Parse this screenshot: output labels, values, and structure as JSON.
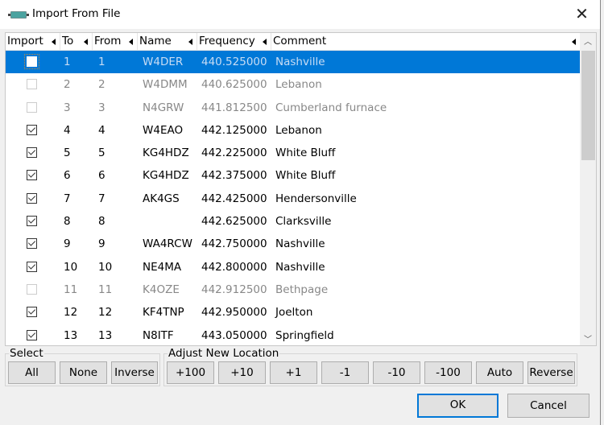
{
  "window": {
    "title": "Import From File",
    "icon": "serial-port-icon",
    "close_glyph": "✕"
  },
  "columns": [
    {
      "key": "import",
      "label": "Import"
    },
    {
      "key": "to",
      "label": "To"
    },
    {
      "key": "from",
      "label": "From"
    },
    {
      "key": "name",
      "label": "Name"
    },
    {
      "key": "frequency",
      "label": "Frequency"
    },
    {
      "key": "comment",
      "label": "Comment"
    }
  ],
  "rows": [
    {
      "import": false,
      "to": "1",
      "from": "1",
      "name": "W4DER",
      "frequency": "440.525000",
      "comment": "Nashville",
      "selected": true,
      "disabled": false
    },
    {
      "import": false,
      "to": "2",
      "from": "2",
      "name": "W4DMM",
      "frequency": "440.625000",
      "comment": "Lebanon",
      "selected": false,
      "disabled": true
    },
    {
      "import": false,
      "to": "3",
      "from": "3",
      "name": "N4GRW",
      "frequency": "441.812500",
      "comment": "Cumberland furnace",
      "selected": false,
      "disabled": true
    },
    {
      "import": true,
      "to": "4",
      "from": "4",
      "name": "W4EAO",
      "frequency": "442.125000",
      "comment": "Lebanon",
      "selected": false,
      "disabled": false
    },
    {
      "import": true,
      "to": "5",
      "from": "5",
      "name": "KG4HDZ",
      "frequency": "442.225000",
      "comment": "White Bluff",
      "selected": false,
      "disabled": false
    },
    {
      "import": true,
      "to": "6",
      "from": "6",
      "name": "KG4HDZ",
      "frequency": "442.375000",
      "comment": "White Bluff",
      "selected": false,
      "disabled": false
    },
    {
      "import": true,
      "to": "7",
      "from": "7",
      "name": "AK4GS",
      "frequency": "442.425000",
      "comment": "Hendersonville",
      "selected": false,
      "disabled": false
    },
    {
      "import": true,
      "to": "8",
      "from": "8",
      "name": "",
      "frequency": "442.625000",
      "comment": "Clarksville",
      "selected": false,
      "disabled": false
    },
    {
      "import": true,
      "to": "9",
      "from": "9",
      "name": "WA4RCW",
      "frequency": "442.750000",
      "comment": "Nashville",
      "selected": false,
      "disabled": false
    },
    {
      "import": true,
      "to": "10",
      "from": "10",
      "name": "NE4MA",
      "frequency": "442.800000",
      "comment": "Nashville",
      "selected": false,
      "disabled": false
    },
    {
      "import": false,
      "to": "11",
      "from": "11",
      "name": "K4OZE",
      "frequency": "442.912500",
      "comment": "Bethpage",
      "selected": false,
      "disabled": true
    },
    {
      "import": true,
      "to": "12",
      "from": "12",
      "name": "KF4TNP",
      "frequency": "442.950000",
      "comment": "Joelton",
      "selected": false,
      "disabled": false
    },
    {
      "import": true,
      "to": "13",
      "from": "13",
      "name": "N8ITF",
      "frequency": "443.050000",
      "comment": "Springfield",
      "selected": false,
      "disabled": false
    }
  ],
  "scrollbar": {
    "up_glyph": "︿",
    "down_glyph": "﹀"
  },
  "select_group": {
    "label": "Select",
    "buttons": [
      "All",
      "None",
      "Inverse"
    ]
  },
  "adjust_group": {
    "label": "Adjust New Location",
    "buttons": [
      "+100",
      "+10",
      "+1",
      "-1",
      "-10",
      "-100",
      "Auto",
      "Reverse"
    ]
  },
  "dialog_buttons": {
    "ok": "OK",
    "cancel": "Cancel"
  }
}
